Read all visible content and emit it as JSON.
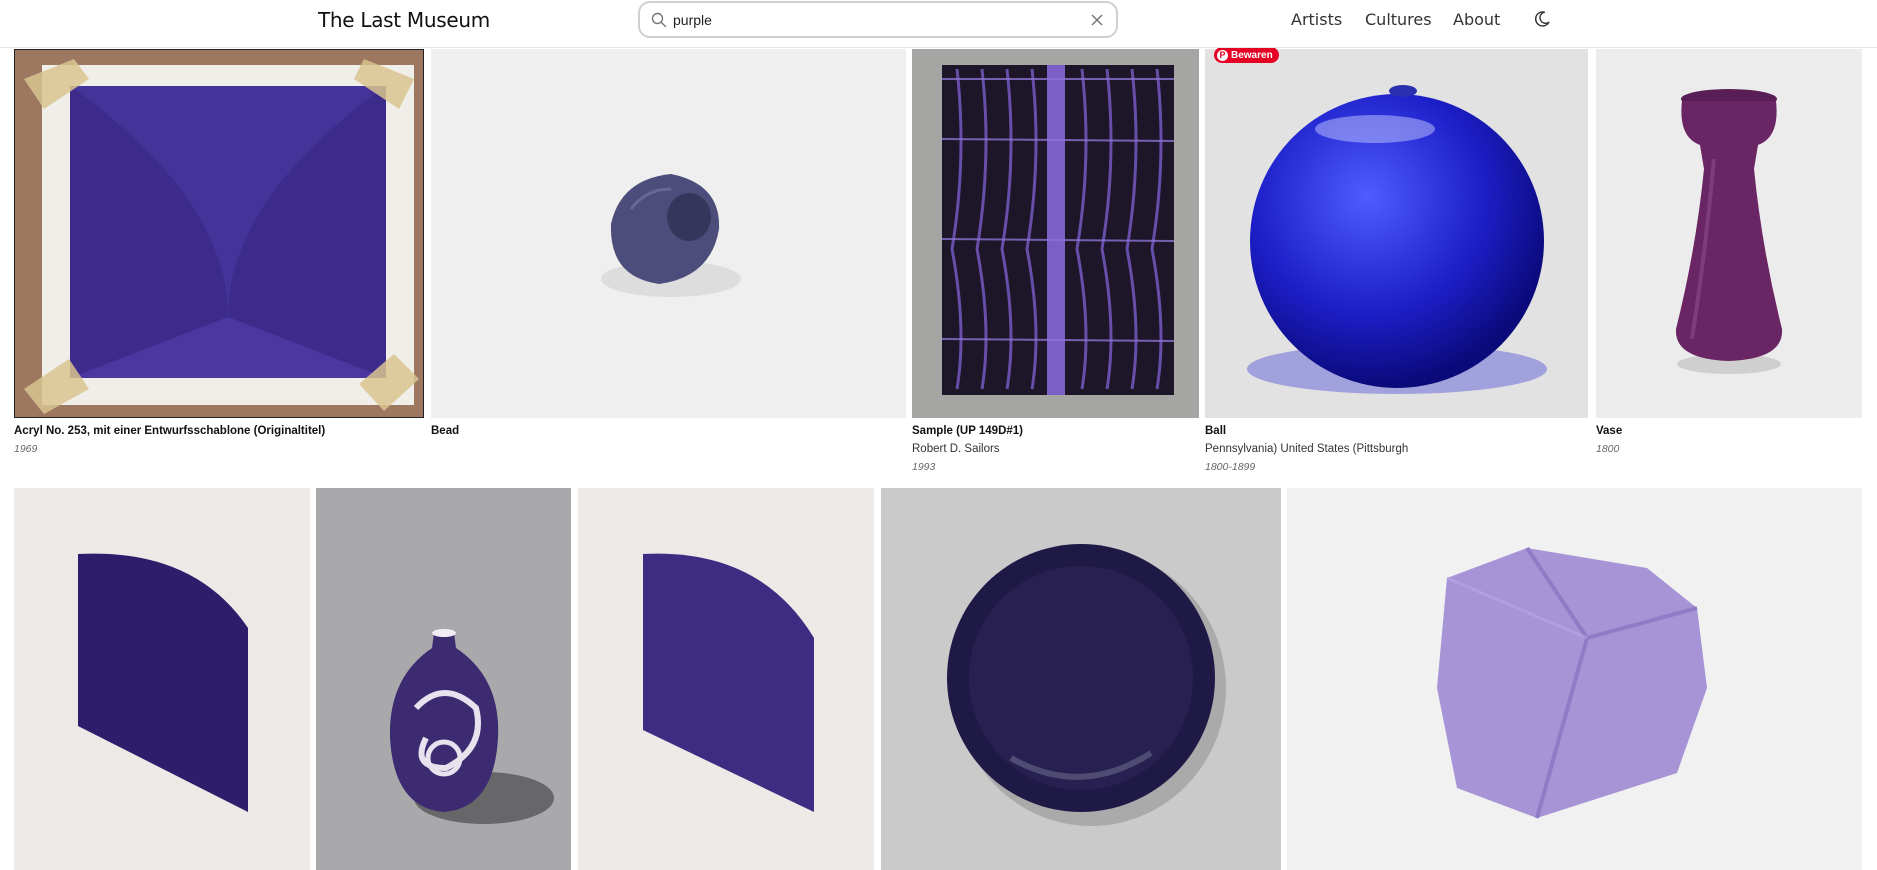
{
  "header": {
    "logo": "The Last Museum",
    "search": {
      "value": "purple",
      "placeholder": "Search"
    },
    "nav": [
      "Artists",
      "Cultures",
      "About"
    ],
    "theme_icon": "moon-icon"
  },
  "pin_button": {
    "label": "Bewaren"
  },
  "row1": [
    {
      "title": "Acryl No. 253, mit einer Entwurfsschablone (Originaltitel)",
      "sub": "",
      "date": "1969"
    },
    {
      "title": "Bead",
      "sub": "",
      "date": ""
    },
    {
      "title": "Sample (UP 149D#1)",
      "sub": "Robert D. Sailors",
      "date": "1993"
    },
    {
      "title": "Ball",
      "sub": "Pennsylvania) United States (Pittsburgh",
      "date": "1800-1899"
    },
    {
      "title": "Vase",
      "sub": "",
      "date": "1800"
    }
  ],
  "row2": [
    {
      "title": "",
      "image": "purple-quarter-circle-print"
    },
    {
      "title": "",
      "image": "purple-vase-with-swirls"
    },
    {
      "title": "",
      "image": "purple-quarter-circle-print-2"
    },
    {
      "title": "",
      "image": "dark-purple-bowl"
    },
    {
      "title": "",
      "image": "lavender-felt-object"
    }
  ],
  "colors": {
    "accent_pin": "#e60023",
    "purple_primary": "#3a2a86"
  }
}
